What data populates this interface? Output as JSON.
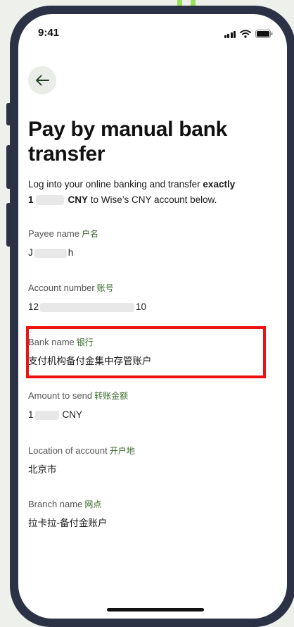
{
  "status_bar": {
    "time": "9:41",
    "signal_icon": "signal-bars-icon",
    "wifi_icon": "wifi-icon",
    "battery_icon": "battery-icon"
  },
  "nav": {
    "back_icon": "arrow-left-icon"
  },
  "page": {
    "title": "Pay by manual bank transfer",
    "intro_prefix": "Log into your online banking and transfer ",
    "intro_bold": "exactly",
    "amount_start": "1",
    "amount_currency": "CNY",
    "intro_suffix": " to Wise’s CNY account below."
  },
  "fields": [
    {
      "label": "Payee name",
      "label_cn": "户名",
      "value_start": "J",
      "value_end": "h"
    },
    {
      "label": "Account number",
      "label_cn": "账号",
      "value_start": "12",
      "value_end": "10"
    },
    {
      "label": "Bank name",
      "label_cn": "银行",
      "value": "支付机构备付金集中存管账户"
    },
    {
      "label": "Amount to send",
      "label_cn": "转账金额",
      "value_start": "1",
      "value_end": "CNY"
    },
    {
      "label": "Location of account",
      "label_cn": "开户地",
      "value": "北京市"
    },
    {
      "label": "Branch name",
      "label_cn": "网点",
      "value": "拉卡拉-备付金账户"
    }
  ],
  "colors": {
    "accent_green": "#9be15d",
    "highlight_red": "#ee1111",
    "label_cn_green": "#3b6b2d"
  }
}
